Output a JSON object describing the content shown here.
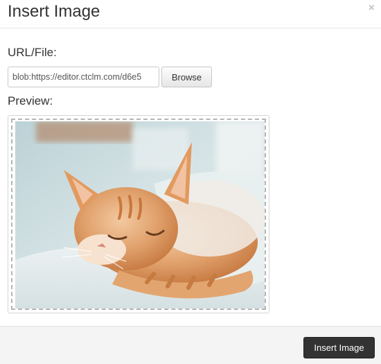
{
  "dialog": {
    "title": "Insert Image",
    "close_symbol": "×"
  },
  "form": {
    "url_label": "URL/File:",
    "url_value": "blob:https://editor.ctclm.com/d6e5",
    "browse_label": "Browse",
    "preview_label": "Preview:",
    "preview_image": "sleeping orange tabby cat curled up on a white blanket"
  },
  "footer": {
    "insert_label": "Insert Image"
  },
  "colors": {
    "primary_button": "#333333",
    "footer_bg": "#f4f4f4"
  }
}
